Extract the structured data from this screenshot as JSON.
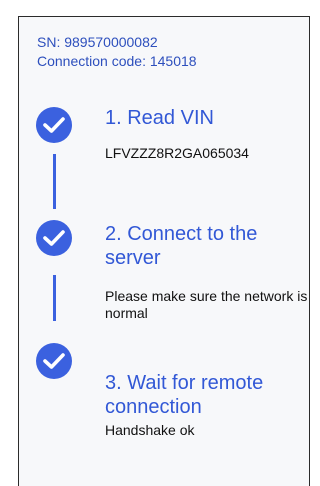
{
  "device": {
    "sn_line": "SN: 989570000082",
    "connection_code_line": "Connection code: 145018"
  },
  "steps": [
    {
      "title": "1. Read VIN",
      "description": "LFVZZZ8R2GA065034",
      "status": "done",
      "icon": "check-circle-icon"
    },
    {
      "title": "2. Connect to the server",
      "description": "Please make sure the network is normal",
      "status": "done",
      "icon": "check-circle-icon"
    },
    {
      "title": "3. Wait for remote connection",
      "description": "Handshake ok",
      "status": "done",
      "icon": "check-circle-icon"
    }
  ],
  "colors": {
    "accent": "#3b61df",
    "title": "#3258d6",
    "info_text": "#2d4fbd"
  }
}
